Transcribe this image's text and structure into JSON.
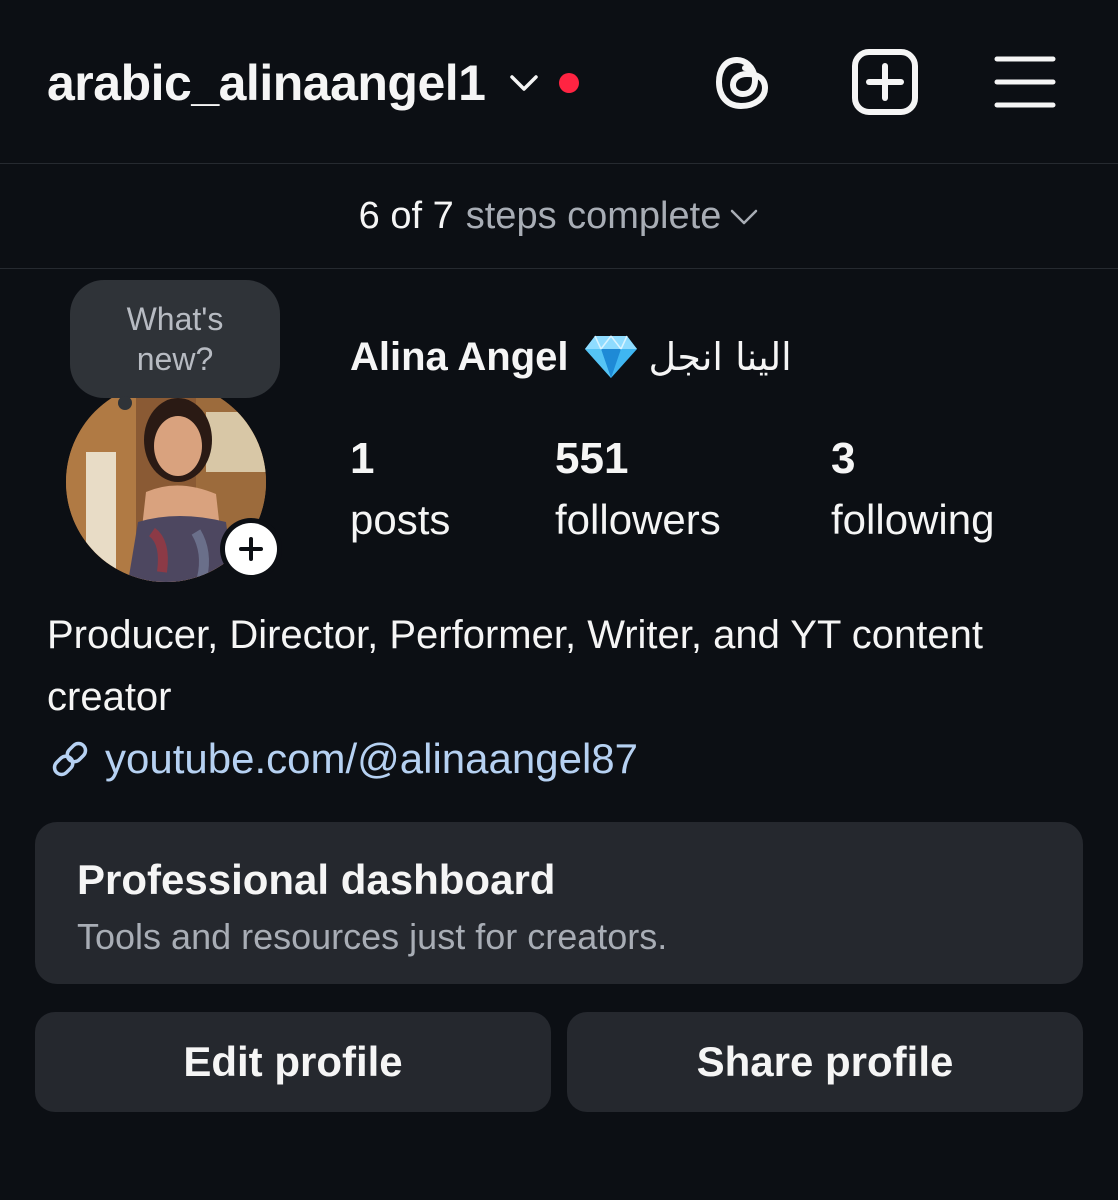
{
  "header": {
    "username": "arabic_alinaangel1",
    "icons": [
      "chevron-down-icon",
      "notification-dot",
      "threads-icon",
      "create-post-icon",
      "menu-icon"
    ]
  },
  "steps": {
    "count": "6 of 7",
    "text": "steps complete"
  },
  "avatar": {
    "bubble_line1": "What's",
    "bubble_line2": "new?"
  },
  "profile": {
    "display_name": "Alina Angel",
    "name_icon": "gem-icon",
    "arabic_name": "الينا انجل"
  },
  "stats": [
    {
      "value": "1",
      "label": "posts"
    },
    {
      "value": "551",
      "label": "followers"
    },
    {
      "value": "3",
      "label": "following"
    }
  ],
  "bio": {
    "text": "Producer, Director, Performer, Writer, and YT content creator",
    "link": "youtube.com/@alinaangel87"
  },
  "dashboard": {
    "title": "Professional dashboard",
    "subtitle": "Tools and resources just for creators."
  },
  "buttons": {
    "edit": "Edit profile",
    "share": "Share profile"
  },
  "colors": {
    "background": "#0c0f14",
    "card": "#25282e",
    "notification_dot": "#ff2442",
    "link": "#b6d1f2",
    "secondary_text": "#a8adb5"
  }
}
